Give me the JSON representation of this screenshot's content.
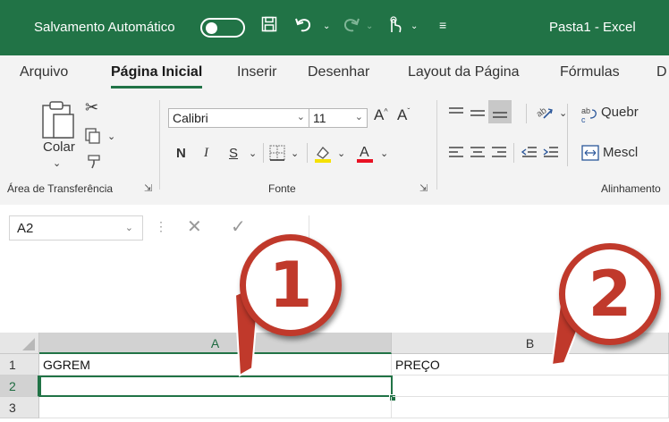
{
  "titlebar": {
    "autosave_label": "Salvamento Automático",
    "window_title": "Pasta1  -  Excel"
  },
  "tabs": [
    "Arquivo",
    "Página Inicial",
    "Inserir",
    "Desenhar",
    "Layout da Página",
    "Fórmulas",
    "D"
  ],
  "ribbon": {
    "clipboard": {
      "paste_label": "Colar",
      "group_label": "Área de Transferência"
    },
    "font": {
      "font_name": "Calibri",
      "font_size": "11",
      "bold": "N",
      "italic": "I",
      "underline": "S",
      "group_label": "Fonte"
    },
    "alignment": {
      "wrap_label": "Quebr",
      "merge_label": "Mescl",
      "group_label": "Alinhamento"
    }
  },
  "formula_bar": {
    "name_box": "A2"
  },
  "grid": {
    "columns": [
      "A",
      "B"
    ],
    "rows": [
      {
        "num": "1",
        "cells": [
          "GGREM",
          "PREÇO"
        ]
      },
      {
        "num": "2",
        "cells": [
          "",
          ""
        ]
      },
      {
        "num": "3",
        "cells": [
          "",
          ""
        ]
      }
    ],
    "active_cell": "A2"
  },
  "callouts": [
    "1",
    "2"
  ],
  "colors": {
    "excel_green": "#217346",
    "callout_red": "#c0392b"
  }
}
